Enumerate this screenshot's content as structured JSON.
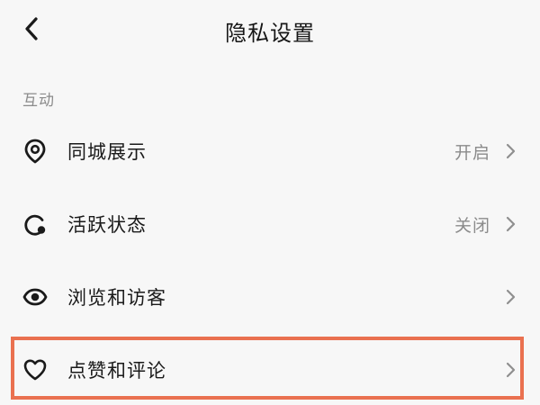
{
  "header": {
    "title": "隐私设置",
    "back_icon": "chevron-left-icon"
  },
  "section": {
    "title": "互动"
  },
  "rows": [
    {
      "label": "同城展示",
      "value": "开启",
      "icon": "location-pin-icon"
    },
    {
      "label": "活跃状态",
      "value": "关闭",
      "icon": "activity-status-icon"
    },
    {
      "label": "浏览和访客",
      "value": "",
      "icon": "eye-icon"
    },
    {
      "label": "点赞和评论",
      "value": "",
      "icon": "heart-icon"
    }
  ],
  "colors": {
    "background": "#f7f7f7",
    "text": "#1a1a1a",
    "secondary_text": "#8b8b8b",
    "chevron": "#8f8f8f",
    "highlight": "#ea7150"
  }
}
